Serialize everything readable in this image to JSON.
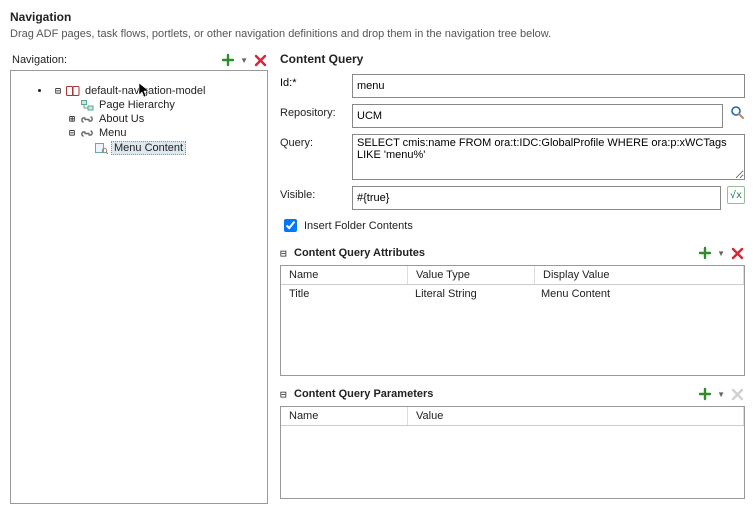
{
  "header": {
    "title": "Navigation",
    "desc": "Drag ADF pages, task flows, portlets, or other navigation definitions and drop them in the navigation tree below."
  },
  "nav": {
    "label": "Navigation:",
    "items": {
      "root": {
        "label": "default-navigation-model"
      },
      "page_hierarchy": {
        "label": "Page Hierarchy"
      },
      "about_us": {
        "label": "About Us"
      },
      "menu": {
        "label": "Menu"
      },
      "menu_content": {
        "label": "Menu Content"
      }
    }
  },
  "cq": {
    "title": "Content Query",
    "id_label": "Id:*",
    "id_value": "menu",
    "repo_label": "Repository:",
    "repo_value": "UCM",
    "query_label": "Query:",
    "query_value": "SELECT cmis:name FROM ora:t:IDC:GlobalProfile WHERE ora:p:xWCTags LIKE 'menu%'",
    "visible_label": "Visible:",
    "visible_value": "#{true}",
    "insert_label": "Insert Folder Contents"
  },
  "attrs": {
    "title": "Content Query Attributes",
    "cols": {
      "name": "Name",
      "vtype": "Value Type",
      "dval": "Display Value"
    },
    "rows": [
      {
        "name": "Title",
        "vtype": "Literal String",
        "dval": "Menu Content"
      }
    ]
  },
  "params": {
    "title": "Content Query Parameters",
    "cols": {
      "name": "Name",
      "value": "Value"
    }
  }
}
